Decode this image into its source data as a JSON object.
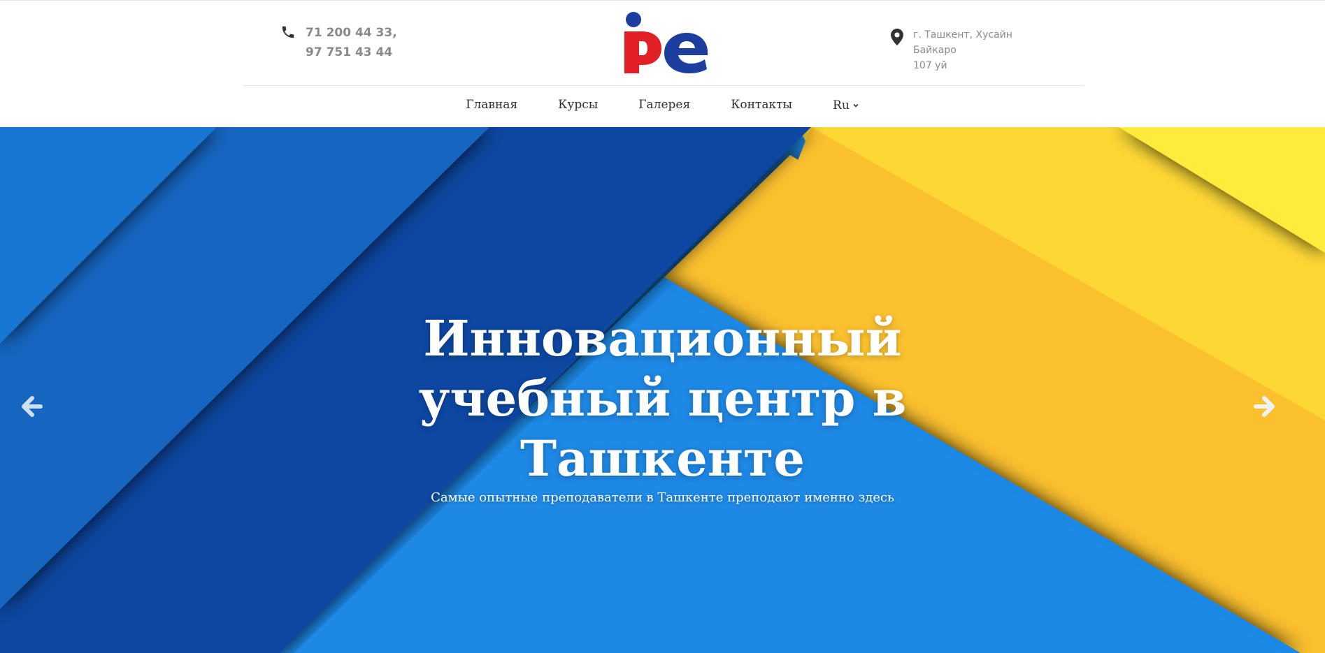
{
  "header": {
    "phone_line1": "71 200 44 33,",
    "phone_line2": "97 751 43 44",
    "address_line1": "г. Ташкент, Хусайн Байкаро",
    "address_line2": "107 уй",
    "logo_colors": {
      "red": "#e21e26",
      "blue": "#1c3e9e"
    }
  },
  "nav": {
    "items": [
      "Главная",
      "Курсы",
      "Галерея",
      "Контакты"
    ],
    "language": "Ru"
  },
  "hero": {
    "title_line1": "Инновационный",
    "title_line2": "учебный центр в",
    "title_line3": "Ташкенте",
    "subtitle": "Самые опытные преподаватели в Ташкенте преподают именно здесь",
    "colors": {
      "blue_light": "#1e88e5",
      "blue_mid": "#1565c0",
      "blue_dark": "#0d47a1",
      "yellow": "#fbc02d",
      "yellow_light": "#fdd835"
    }
  },
  "icons": {
    "phone": "phone-icon",
    "pin": "map-pin-icon",
    "prev": "arrow-left-icon",
    "next": "arrow-right-icon",
    "chevron": "chevron-down-icon"
  }
}
